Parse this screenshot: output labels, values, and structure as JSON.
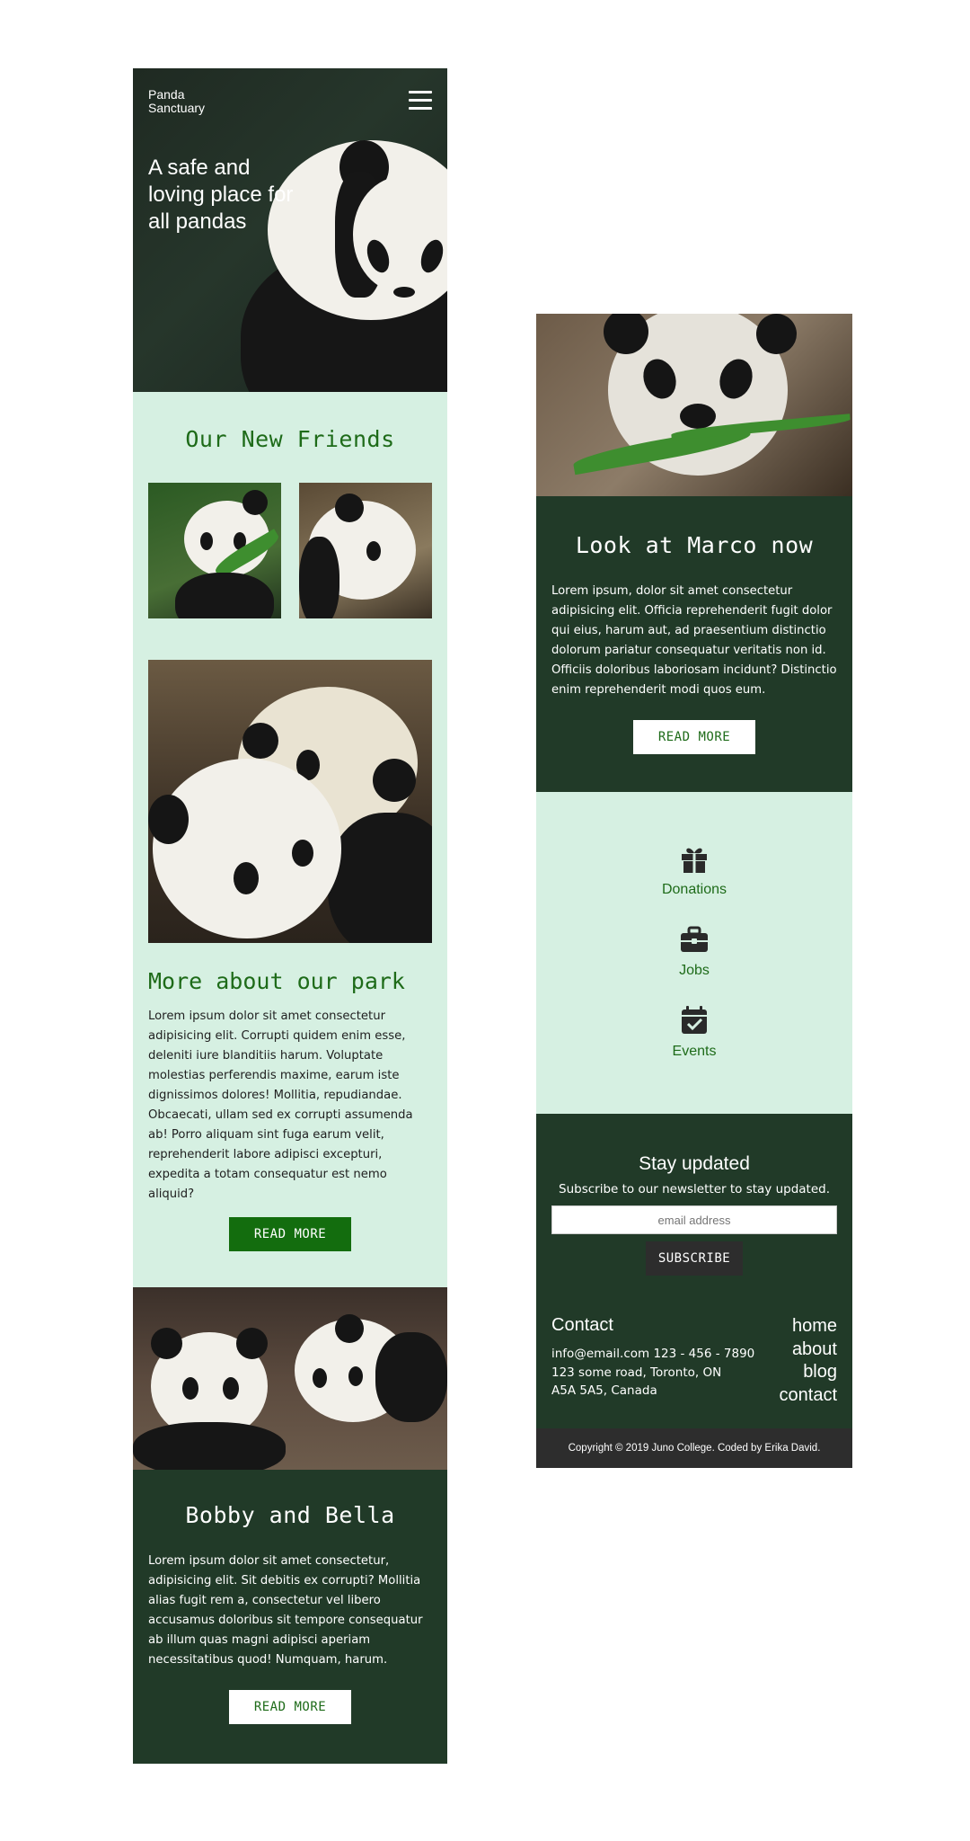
{
  "hero": {
    "brand_line1": "Panda",
    "brand_line2": "Sanctuary",
    "title": "A safe and loving place for all pandas",
    "menu_icon": "hamburger-icon"
  },
  "friends": {
    "title": "Our New Friends",
    "park_title": "More about our park",
    "park_text": "Lorem ipsum dolor sit amet consectetur adipisicing elit. Corrupti quidem enim esse, deleniti iure blanditiis harum. Voluptate molestias perferendis maxime, earum iste dignissimos dolores! Mollitia, repudiandae. Obcaecati, ullam sed ex corrupti assumenda ab! Porro aliquam sint fuga earum velit, reprehenderit labore adipisci excepturi, expedita a totam consequatur est nemo aliquid?",
    "park_button": "READ MORE"
  },
  "bobby": {
    "title": "Bobby and Bella",
    "text": "Lorem ipsum dolor sit amet consectetur, adipisicing elit. Sit debitis ex corrupti? Mollitia alias fugit rem a, consectetur vel libero accusamus doloribus sit tempore consequatur ab illum quas magni adipisci aperiam necessitatibus quod! Numquam, harum.",
    "button": "READ MORE"
  },
  "marco": {
    "title": "Look at Marco now",
    "text": "Lorem ipsum, dolor sit amet consectetur adipisicing elit. Officia reprehenderit fugit dolor qui eius, harum aut, ad praesentium distinctio dolorum pariatur consequatur veritatis non id. Officiis doloribus laboriosam incidunt? Distinctio enim reprehenderit modi quos eum.",
    "button": "READ MORE"
  },
  "links": [
    {
      "label": "Donations",
      "icon": "gift-icon"
    },
    {
      "label": "Jobs",
      "icon": "briefcase-icon"
    },
    {
      "label": "Events",
      "icon": "calendar-check-icon"
    }
  ],
  "newsletter": {
    "title": "Stay updated",
    "subtitle": "Subscribe to our newsletter to stay updated.",
    "placeholder": "email address",
    "button": "SUBSCRIBE"
  },
  "contact": {
    "title": "Contact",
    "line1": "info@email.com 123 - 456 - 7890",
    "line2": "123 some road, Toronto, ON",
    "line3": "A5A 5A5, Canada"
  },
  "nav": [
    "home",
    "about",
    "blog",
    "contact"
  ],
  "footer": {
    "copyright": "Copyright © 2019 Juno College. Coded by Erika David."
  },
  "colors": {
    "dark_green": "#213a28",
    "mint": "#d6f0e2",
    "accent_green": "#136d0e",
    "text_green": "#1e6b19",
    "footer_gray": "#2d2d2d"
  }
}
